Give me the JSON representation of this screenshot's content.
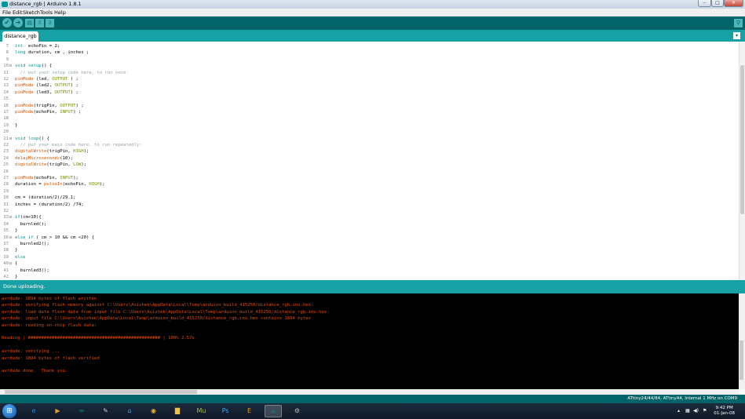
{
  "window": {
    "title": "distance_rgb | Arduino 1.8.1",
    "controls": [
      "–",
      "□",
      "✕"
    ]
  },
  "menu": [
    "File",
    "Edit",
    "Sketch",
    "Tools",
    "Help"
  ],
  "toolbar": {
    "verify": "✔",
    "upload": "➜",
    "new": "▤",
    "open": "⇧",
    "save": "⇩",
    "serial_monitor": "⚲"
  },
  "tab": {
    "name": "distance_rgb",
    "menu": "▾"
  },
  "code": [
    {
      "n": "7",
      "fold": "",
      "segs": [
        [
          "k",
          "int"
        ],
        [
          "",
          "  echoPin = 2;"
        ]
      ]
    },
    {
      "n": "8",
      "fold": "",
      "segs": [
        [
          "k",
          "long"
        ],
        [
          "",
          " duration, cm , inches ;"
        ]
      ]
    },
    {
      "n": "9",
      "fold": "",
      "segs": []
    },
    {
      "n": "10",
      "fold": "⊟",
      "segs": [
        [
          "k",
          "void"
        ],
        [
          "",
          " "
        ],
        [
          "k",
          "setup"
        ],
        [
          "",
          "() {"
        ]
      ]
    },
    {
      "n": "11",
      "fold": "",
      "segs": [
        [
          "c",
          "  // put your setup code here, to run once:"
        ]
      ]
    },
    {
      "n": "12",
      "fold": "",
      "segs": [
        [
          "f",
          "pinMode"
        ],
        [
          "",
          " (led, "
        ],
        [
          "t",
          "OUTPUT"
        ],
        [
          "",
          " ) ;"
        ]
      ]
    },
    {
      "n": "13",
      "fold": "",
      "segs": [
        [
          "f",
          "pinMode"
        ],
        [
          "",
          " (led2, "
        ],
        [
          "t",
          "OUTPUT"
        ],
        [
          "",
          ") ;"
        ]
      ]
    },
    {
      "n": "14",
      "fold": "",
      "segs": [
        [
          "f",
          "pinMode"
        ],
        [
          "",
          " (led3, "
        ],
        [
          "t",
          "OUTPUT"
        ],
        [
          "",
          ") ;"
        ]
      ]
    },
    {
      "n": "15",
      "fold": "",
      "segs": []
    },
    {
      "n": "16",
      "fold": "",
      "segs": [
        [
          "f",
          "pinMode"
        ],
        [
          "",
          "(trigPin, "
        ],
        [
          "t",
          "OUTPUT"
        ],
        [
          "",
          ") ;"
        ]
      ]
    },
    {
      "n": "17",
      "fold": "",
      "segs": [
        [
          "f",
          "pinMode"
        ],
        [
          "",
          "(echoPin, "
        ],
        [
          "t",
          "INPUT"
        ],
        [
          "",
          ") ;"
        ]
      ]
    },
    {
      "n": "18",
      "fold": "",
      "segs": []
    },
    {
      "n": "19",
      "fold": "",
      "segs": [
        [
          "",
          "}"
        ]
      ]
    },
    {
      "n": "20",
      "fold": "",
      "segs": []
    },
    {
      "n": "21",
      "fold": "⊟",
      "segs": [
        [
          "k",
          "void"
        ],
        [
          "",
          " "
        ],
        [
          "k",
          "loop"
        ],
        [
          "",
          "() {"
        ]
      ]
    },
    {
      "n": "22",
      "fold": "",
      "segs": [
        [
          "c",
          "  // put your main code here, to run repeatedly:"
        ]
      ]
    },
    {
      "n": "23",
      "fold": "",
      "segs": [
        [
          "f",
          "digitalWrite"
        ],
        [
          "",
          "(trigPin, "
        ],
        [
          "t",
          "HIGH"
        ],
        [
          "",
          ");"
        ]
      ]
    },
    {
      "n": "24",
      "fold": "",
      "segs": [
        [
          "f",
          "delayMicroseconds"
        ],
        [
          "",
          "(10);"
        ]
      ]
    },
    {
      "n": "25",
      "fold": "",
      "segs": [
        [
          "f",
          "digitalWrite"
        ],
        [
          "",
          "(trigPin, "
        ],
        [
          "t",
          "LOW"
        ],
        [
          "",
          ");"
        ]
      ]
    },
    {
      "n": "26",
      "fold": "",
      "segs": []
    },
    {
      "n": "27",
      "fold": "",
      "segs": [
        [
          "f",
          "pinMode"
        ],
        [
          "",
          "(echoPin, "
        ],
        [
          "t",
          "INPUT"
        ],
        [
          "",
          ");"
        ]
      ]
    },
    {
      "n": "28",
      "fold": "",
      "segs": [
        [
          "",
          "duration = "
        ],
        [
          "f",
          "pulseIn"
        ],
        [
          "",
          "(echoPin, "
        ],
        [
          "t",
          "HIGH"
        ],
        [
          "",
          ");"
        ]
      ]
    },
    {
      "n": "29",
      "fold": "",
      "segs": []
    },
    {
      "n": "30",
      "fold": "",
      "segs": [
        [
          "",
          "cm = (duration/2)/29.1;"
        ]
      ]
    },
    {
      "n": "31",
      "fold": "",
      "segs": [
        [
          "",
          "inches = (duration/2) /74;"
        ]
      ]
    },
    {
      "n": "32",
      "fold": "",
      "segs": []
    },
    {
      "n": "33",
      "fold": "⊟",
      "segs": [
        [
          "k",
          "if"
        ],
        [
          "",
          "(cm<10){"
        ]
      ]
    },
    {
      "n": "34",
      "fold": "",
      "segs": [
        [
          "",
          "  burnled();"
        ]
      ]
    },
    {
      "n": "35",
      "fold": "",
      "segs": [
        [
          "",
          "}"
        ]
      ]
    },
    {
      "n": "36",
      "fold": "⊟",
      "segs": [
        [
          "k",
          "else"
        ],
        [
          "",
          " "
        ],
        [
          "k",
          "if"
        ],
        [
          "",
          " ( cm > 10 && cm <20) {"
        ]
      ]
    },
    {
      "n": "37",
      "fold": "",
      "segs": [
        [
          "",
          "  burnled2();"
        ]
      ]
    },
    {
      "n": "38",
      "fold": "",
      "segs": [
        [
          "",
          "}"
        ]
      ]
    },
    {
      "n": "39",
      "fold": "",
      "segs": [
        [
          "k",
          "else"
        ]
      ]
    },
    {
      "n": "40",
      "fold": "⊟",
      "segs": [
        [
          "",
          "{"
        ]
      ]
    },
    {
      "n": "41",
      "fold": "",
      "segs": [
        [
          "",
          "  burnled3();"
        ]
      ]
    },
    {
      "n": "42",
      "fold": "",
      "segs": [
        [
          "",
          "}"
        ]
      ]
    }
  ],
  "status": "Done uploading.",
  "console": [
    "avrdude: 1894 bytes of flash written",
    "avrdude: verifying flash memory against C:\\Users\\Avishek\\AppData\\Local\\Temp\\arduino_build_415250/distance_rgb.ino.hex:",
    "avrdude: load data flash data from input file C:\\Users\\Avishek\\AppData\\Local\\Temp\\arduino_build_415250/distance_rgb.ino.hex:",
    "avrdude: input file C:\\Users\\Avishek\\AppData\\Local\\Temp\\arduino_build_415250/distance_rgb.ino.hex contains 1894 bytes",
    "avrdude: reading on-chip flash data:",
    "",
    "Reading | ################################################## | 100% 2.57s",
    "",
    "avrdude: verifying ...",
    "avrdude: 1894 bytes of flash verified",
    "",
    "avrdude done.  Thank you."
  ],
  "board_info": "ATtiny24/44/84, ATtiny44, Internal 1 MHz on COM9",
  "taskbar": {
    "start": "⊞",
    "apps": [
      {
        "name": "ie",
        "glyph": "e",
        "color": "#1e88e5",
        "active": false
      },
      {
        "name": "media-player",
        "glyph": "▶",
        "color": "#e0a030",
        "active": false
      },
      {
        "name": "arduino",
        "glyph": "∞",
        "color": "#00979c",
        "active": false
      },
      {
        "name": "inkscape",
        "glyph": "✎",
        "color": "#cccccc",
        "active": false
      },
      {
        "name": "sketchup",
        "glyph": "⌂",
        "color": "#4fa3d8",
        "active": false
      },
      {
        "name": "chrome",
        "glyph": "◉",
        "color": "#e8b93c",
        "active": false
      },
      {
        "name": "explorer",
        "glyph": "▇",
        "color": "#f0c040",
        "active": false
      },
      {
        "name": "muse",
        "glyph": "Mu",
        "color": "#a6c03d",
        "active": false
      },
      {
        "name": "photoshop",
        "glyph": "Ps",
        "color": "#3fa8f4",
        "active": false
      },
      {
        "name": "eagle",
        "glyph": "E",
        "color": "#f39c12",
        "active": false
      },
      {
        "name": "arduino-active",
        "glyph": "∞",
        "color": "#00979c",
        "active": true
      },
      {
        "name": "tool",
        "glyph": "⚙",
        "color": "#bbbbbb",
        "active": false
      }
    ],
    "time": "9:42 PM",
    "date": "01-Jan-08"
  }
}
